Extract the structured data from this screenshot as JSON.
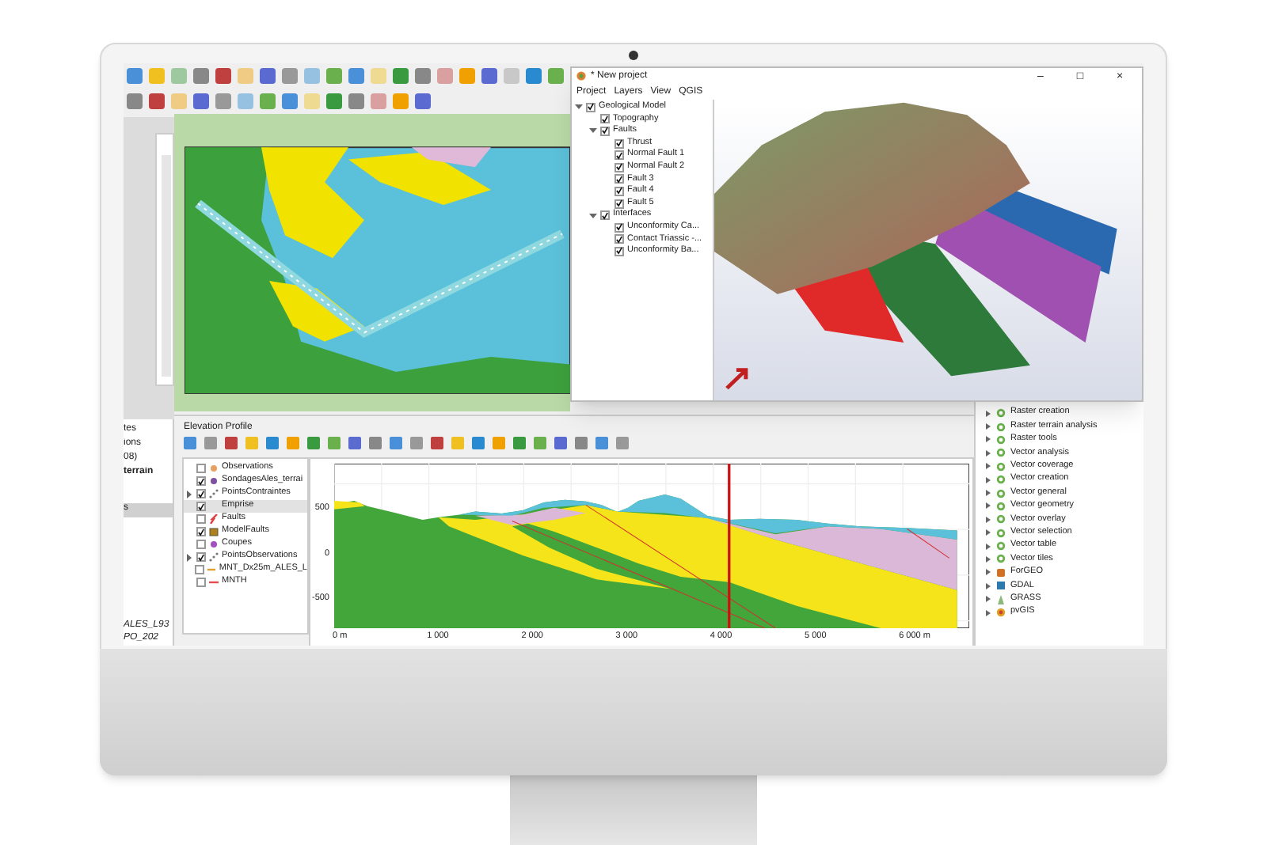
{
  "left_panel": {
    "upper_texts": [
      {
        "text": "tes",
        "bold": false
      },
      {
        "text": "ions",
        "bold": false
      },
      {
        "text": "08)",
        "bold": false
      },
      {
        "text": "terrain",
        "bold": true
      }
    ],
    "selected_row": {
      "text": "s",
      "selected": true
    },
    "lower_texts": [
      "ALES_L93",
      "PO_202"
    ]
  },
  "window_3d": {
    "title": "* New project",
    "controls": [
      "–",
      "□",
      "×"
    ],
    "menu": [
      "Project",
      "Layers",
      "View",
      "QGIS"
    ],
    "tree": [
      {
        "label": "Geological Model",
        "checked": true,
        "expanded": true,
        "children": [
          {
            "label": "Topography",
            "checked": true
          },
          {
            "label": "Faults",
            "checked": true,
            "expanded": true,
            "children": [
              {
                "label": "Thrust",
                "checked": true
              },
              {
                "label": "Normal Fault 1",
                "checked": true
              },
              {
                "label": "Normal Fault 2",
                "checked": true
              },
              {
                "label": "Fault 3",
                "checked": true
              },
              {
                "label": "Fault 4",
                "checked": true
              },
              {
                "label": "Fault 5",
                "checked": true
              }
            ]
          },
          {
            "label": "Interfaces",
            "checked": true,
            "expanded": true,
            "children": [
              {
                "label": "Unconformity Ca...",
                "checked": true
              },
              {
                "label": "Contact Triassic -...",
                "checked": true
              },
              {
                "label": "Unconformity Ba...",
                "checked": true
              }
            ]
          }
        ]
      }
    ]
  },
  "profile": {
    "title": "Elevation Profile",
    "layers": [
      {
        "name": "Observations",
        "checked": false,
        "expandable": false,
        "selected": false,
        "kind": "dot",
        "color": "#e8a060"
      },
      {
        "name": "SondagesAles_terrai",
        "checked": true,
        "expandable": false,
        "selected": false,
        "kind": "dot",
        "color": "#8050a0"
      },
      {
        "name": "PointsContraintes",
        "checked": true,
        "expandable": true,
        "selected": false,
        "kind": "points",
        "color": "#777777"
      },
      {
        "name": "Emprise",
        "checked": true,
        "expandable": false,
        "selected": true,
        "kind": "none"
      },
      {
        "name": "Faults",
        "checked": false,
        "expandable": false,
        "selected": false,
        "kind": "fault",
        "color": "#e04040"
      },
      {
        "name": "ModelFaults",
        "checked": true,
        "expandable": false,
        "selected": false,
        "kind": "box",
        "color": "#b08020"
      },
      {
        "name": "Coupes",
        "checked": false,
        "expandable": false,
        "selected": false,
        "kind": "dot",
        "color": "#a050c0"
      },
      {
        "name": "PointsObservations",
        "checked": true,
        "expandable": true,
        "selected": false,
        "kind": "points",
        "color": "#777777"
      },
      {
        "name": "MNT_Dx25m_ALES_L",
        "checked": false,
        "expandable": false,
        "selected": false,
        "kind": "line",
        "color": "#e0a030"
      },
      {
        "name": "MNTH",
        "checked": false,
        "expandable": false,
        "selected": false,
        "kind": "line",
        "color": "#e05050"
      }
    ],
    "y_ticks": [
      "500",
      "0",
      "-500"
    ],
    "x_ticks": [
      "0 m",
      "1 000",
      "2 000",
      "3 000",
      "4 000",
      "5 000",
      "6 000 m"
    ]
  },
  "processing": {
    "items": [
      {
        "label": "Raster creation",
        "kind": "qgis"
      },
      {
        "label": "Raster terrain analysis",
        "kind": "qgis"
      },
      {
        "label": "Raster tools",
        "kind": "qgis"
      },
      {
        "label": "Vector analysis",
        "kind": "qgis"
      },
      {
        "label": "Vector coverage",
        "kind": "qgis"
      },
      {
        "label": "Vector creation",
        "kind": "qgis"
      },
      {
        "label": "Vector general",
        "kind": "qgis"
      },
      {
        "label": "Vector geometry",
        "kind": "qgis"
      },
      {
        "label": "Vector overlay",
        "kind": "qgis"
      },
      {
        "label": "Vector selection",
        "kind": "qgis"
      },
      {
        "label": "Vector table",
        "kind": "qgis"
      },
      {
        "label": "Vector tiles",
        "kind": "qgis"
      },
      {
        "label": "ForGEO",
        "kind": "forgeo"
      },
      {
        "label": "GDAL",
        "kind": "gdal"
      },
      {
        "label": "GRASS",
        "kind": "grass"
      },
      {
        "label": "pvGIS",
        "kind": "pvgis"
      }
    ]
  }
}
